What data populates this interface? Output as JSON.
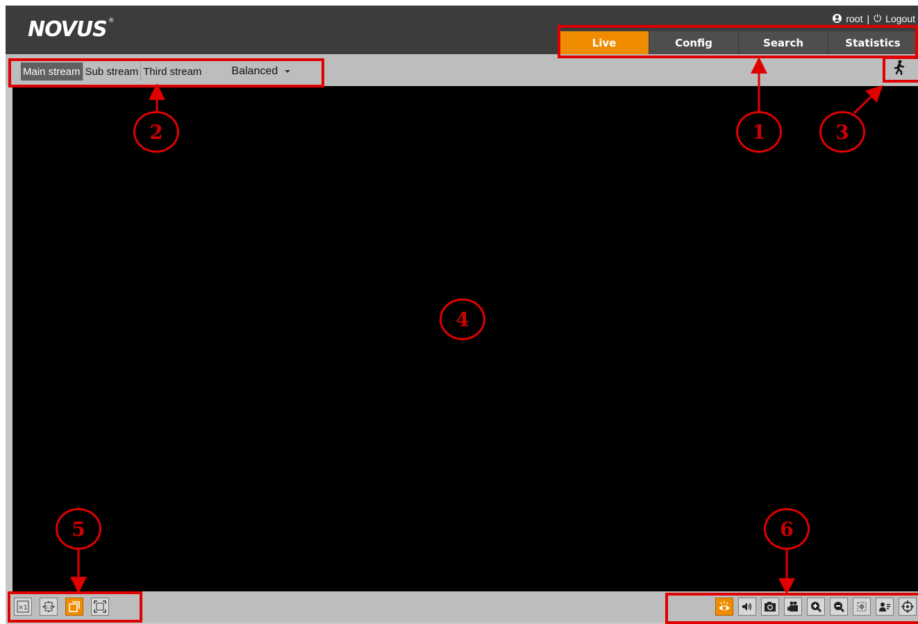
{
  "header": {
    "logo": "NOVUS",
    "user": "root",
    "separator": "|",
    "logout": "Logout"
  },
  "nav": {
    "tabs": [
      {
        "label": "Live",
        "active": true
      },
      {
        "label": "Config",
        "active": false
      },
      {
        "label": "Search",
        "active": false
      },
      {
        "label": "Statistics",
        "active": false
      }
    ]
  },
  "streams": {
    "tabs": [
      "Main stream",
      "Sub stream",
      "Third stream"
    ],
    "active": "Main stream",
    "quality": "Balanced"
  },
  "annotations": {
    "labels": [
      "1",
      "2",
      "3",
      "4",
      "5",
      "6"
    ]
  },
  "bottom_left_tools": [
    "original-size-icon",
    "fit-size-icon",
    "fit-window-icon",
    "fullscreen-icon"
  ],
  "bottom_right_tools": [
    "live-view-icon",
    "audio-icon",
    "snapshot-icon",
    "record-icon",
    "zoom-in-icon",
    "zoom-out-icon",
    "area-zoom-icon",
    "face-detection-icon",
    "ptz-icon"
  ],
  "colors": {
    "accent": "#ef8c00",
    "header": "#3c3c3c",
    "annotation": "#e00000"
  }
}
